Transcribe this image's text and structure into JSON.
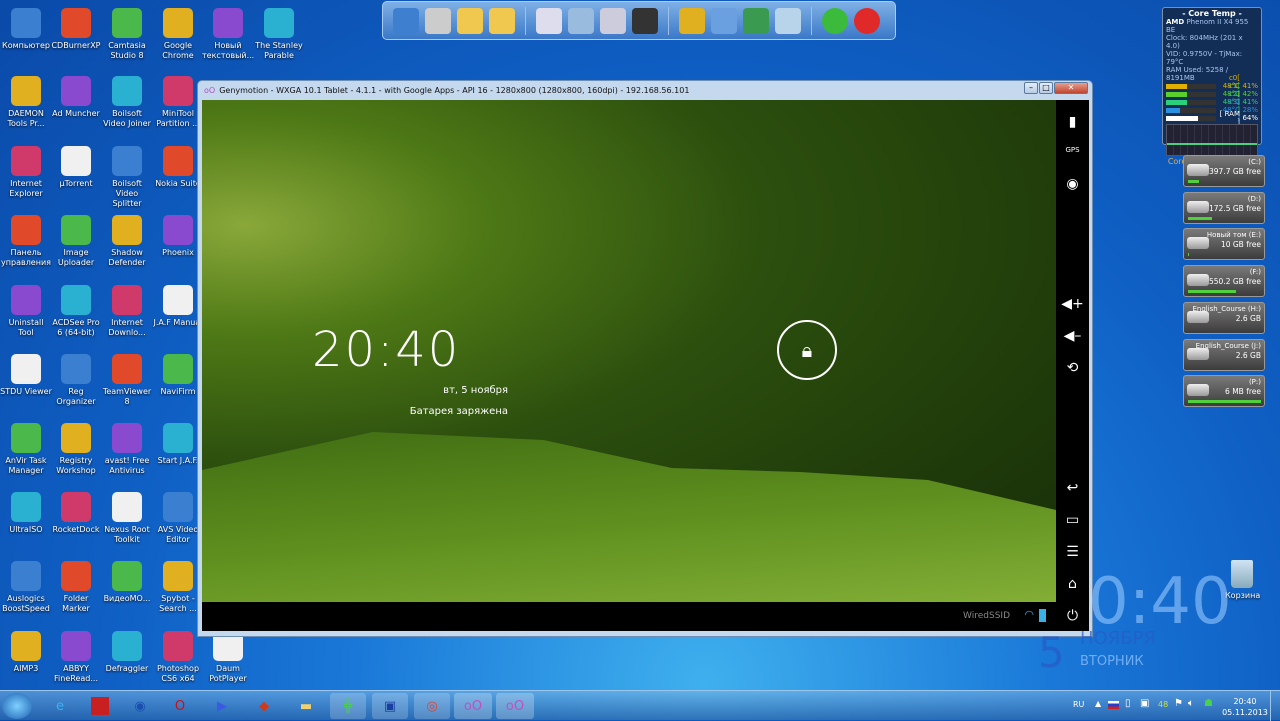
{
  "desktop_icons": [
    [
      "Компьютер",
      "CDBurnerXP",
      "Camtasia Studio 8",
      "Google Chrome",
      "Новый текстовый...",
      "The Stanley Parable"
    ],
    [
      "DAEMON Tools Pr...",
      "Ad Muncher",
      "Boilsoft Video Joiner",
      "MiniTool Partition ..."
    ],
    [
      "Internet Explorer",
      "µTorrent",
      "Boilsoft Video Splitter",
      "Nokia Suite"
    ],
    [
      "Панель управления",
      "Image Uploader",
      "Shadow Defender",
      "Phoenix"
    ],
    [
      "Uninstall Tool",
      "ACDSee Pro 6 (64-bit)",
      "Internet Downlo...",
      "J.A.F Manual"
    ],
    [
      "STDU Viewer",
      "Reg Organizer",
      "TeamViewer 8",
      "NaviFirm"
    ],
    [
      "AnVir Task Manager",
      "Registry Workshop",
      "avast! Free Antivirus",
      "Start J.A.F."
    ],
    [
      "UltraISO",
      "RocketDock",
      "Nexus Root Toolkit",
      "AVS Video Editor"
    ],
    [
      "Auslogics BoostSpeed",
      "Folder Marker",
      "ВидеоМО...",
      "Spybot - Search ..."
    ],
    [
      "AIMP3",
      "ABBYY FineRead...",
      "Defraggler",
      "Photoshop CS6 x64",
      "Daum PotPlayer"
    ]
  ],
  "recycle_bin": "Корзина",
  "genymotion": {
    "title": "Genymotion - WXGA 10.1 Tablet - 4.1.1 - with Google Apps - API 16 - 1280x800 (1280x800, 160dpi) - 192.168.56.101",
    "clock": "20:40",
    "date": "вт, 5 ноября",
    "battery_status": "Батарея заряжена",
    "ssid": "WiredSSID",
    "sidebar_icons": [
      "battery-icon",
      "gps-icon",
      "camera-icon",
      "volume-up-icon",
      "volume-down-icon",
      "rotate-icon",
      "back-icon",
      "recent-apps-icon",
      "menu-icon",
      "home-icon",
      "power-icon"
    ]
  },
  "core_temp": {
    "title": "- Core Temp -",
    "brand": "AMD",
    "cpu": "Phenom II X4 955 BE",
    "clock": "Clock: 804MHz (201 x 4.0)",
    "vid": "VID: 0.9750V - TjMax: 79°C",
    "ram": "RAM Used: 5258 / 8191MB",
    "cores": [
      {
        "label": "c0[ 48°C ]",
        "load": "41%",
        "pct": 41,
        "color": "#e0b000"
      },
      {
        "label": "c1[ 48°C ]",
        "load": "42%",
        "pct": 42,
        "color": "#5ad02a"
      },
      {
        "label": "c2[ 48°C ]",
        "load": "41%",
        "pct": 41,
        "color": "#2ad07a"
      },
      {
        "label": "c3[ 48°C ]",
        "load": "28%",
        "pct": 28,
        "color": "#2a90e0"
      },
      {
        "label": "[ RAM ]",
        "load": "64%",
        "pct": 64,
        "color": "#ffffff"
      }
    ],
    "footer": "Core Temp on Android"
  },
  "drives": [
    {
      "name": "(C:)",
      "free": "397.7 GB free",
      "pct": 15
    },
    {
      "name": "(D:)",
      "free": "172.5 GB free",
      "pct": 32
    },
    {
      "name": "Новый том (E:)",
      "free": "10 GB free",
      "pct": 2
    },
    {
      "name": "(F:)",
      "free": "550.2 GB free",
      "pct": 65
    },
    {
      "name": "English_Course (H:)",
      "free": "2.6 GB",
      "pct": 0
    },
    {
      "name": "English_Course (J:)",
      "free": "2.6 GB",
      "pct": 0
    },
    {
      "name": "(P:)",
      "free": "6 MB free",
      "pct": 99
    }
  ],
  "desktop_clock": {
    "time": "0:40",
    "day": "5",
    "month": "НОЯБРЯ",
    "weekday": "ВТОРНИК"
  },
  "tray": {
    "lang": "RU",
    "temp": "48",
    "time": "20:40",
    "date": "05.11.2013"
  }
}
